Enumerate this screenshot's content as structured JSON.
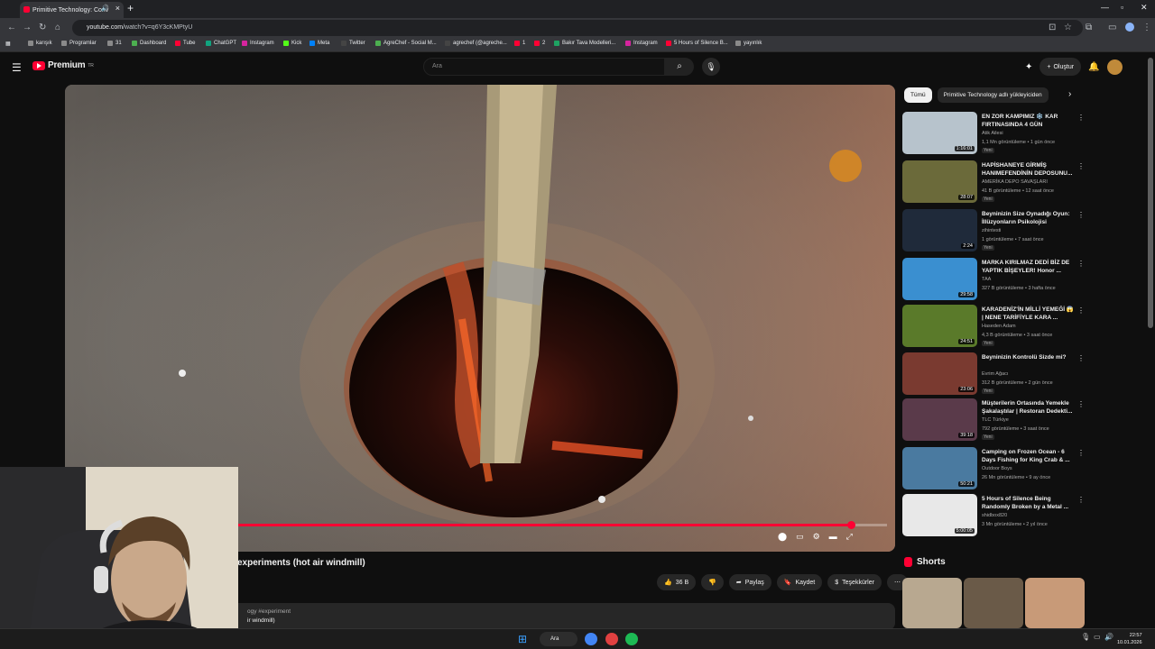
{
  "browser": {
    "tab_title": "Primitive Technology: Conv",
    "url_domain": "youtube.com",
    "url_path": "/watch?v=q6Y3cKMPtyU",
    "bookmarks": [
      "karışık",
      "Programlar",
      "31",
      "Dashboard",
      "Tube",
      "ChatGPT",
      "Instagram",
      "Kick",
      "Meta",
      "Twitter",
      "AgreChef - Social M...",
      "agrechef (@agreche...",
      "1",
      "2",
      "Bakır Tava Modelleri...",
      "Instagram",
      "5 Hours of Silence B...",
      "yayınlık"
    ]
  },
  "youtube": {
    "logo_text": "Premium",
    "logo_sup": "TR",
    "search_placeholder": "Ara",
    "create_label": "Oluştur"
  },
  "video": {
    "title_visible": "experiments (hot air windmill)",
    "progress": 0.945,
    "like_count": "36 B",
    "share_label": "Paylaş",
    "save_label": "Kaydet",
    "thanks_label": "Teşekkürler",
    "description_tags": "ogy #experiment",
    "description_line": "ir windmill)"
  },
  "sidebar": {
    "chips": [
      "Tümü",
      "Primitive Technology adlı yükleyiciden"
    ],
    "recommendations": [
      {
        "title": "EN ZOR KAMPIMIZ ❄️ KAR FIRTINASINDA 4 GÜN",
        "channel": "Atik Ailesi",
        "meta": "1,1 Mn görüntüleme • 1 gün önce",
        "badge": "Yeni",
        "duration": "1:16:01",
        "thumb": "#b7c3cc"
      },
      {
        "title": "HAPİSHANEYE GİRMİŞ HANIMEFENDİNİN DEPOSUNU...",
        "channel": "AMERİKA DEPO SAVAŞLARI",
        "meta": "41 B görüntüleme • 12 saat önce",
        "badge": "Yeni",
        "duration": "28:07",
        "thumb": "#6b6a3a"
      },
      {
        "title": "Beyninizin Size Oynadığı Oyun: İllüzyonların Psikolojisi",
        "channel": "zihintesti",
        "meta": "1 görüntüleme • 7 saat önce",
        "badge": "Yeni",
        "duration": "2:24",
        "thumb": "#1f2a3a"
      },
      {
        "title": "MARKA KIRILMAZ DEDİ BİZ DE YAPTIK BİŞEYLER! Honor ...",
        "channel": "TAA",
        "meta": "327 B görüntüleme • 3 hafta önce",
        "badge": "",
        "duration": "29:58",
        "thumb": "#3a8fd0"
      },
      {
        "title": "KARADENİZ'İN MİLLİ YEMEĞİ 😱 | NENE TARİFİYLE KARA ...",
        "channel": "Haseden Adam",
        "meta": "4,3 B görüntüleme • 3 saat önce",
        "badge": "Yeni",
        "duration": "24:51",
        "thumb": "#5a7a2a"
      },
      {
        "title": "Beyninizin Kontrolü Sizde mi?",
        "channel": "Evrim Ağacı",
        "meta": "312 B görüntüleme • 2 gün önce",
        "badge": "Yeni",
        "duration": "23:06",
        "thumb": "#7a3a30"
      },
      {
        "title": "Müşterilerin Ortasında Yemekle Şakalaştılar | Restoran Dedekti...",
        "channel": "TLC Türkiye",
        "meta": "792 görüntüleme • 3 saat önce",
        "badge": "Yeni",
        "duration": "39:18",
        "thumb": "#5a3a4a"
      },
      {
        "title": "Camping on Frozen Ocean - 6 Days Fishing for King Crab & ...",
        "channel": "Outdoor Boys",
        "meta": "26 Mn görüntüleme • 9 ay önce",
        "badge": "",
        "duration": "50:21",
        "thumb": "#4a7aa0"
      },
      {
        "title": "5 Hours of Silence Being Randomly Broken by a Metal ...",
        "channel": "shidbox820",
        "meta": "3 Mn görüntüleme • 2 yıl önce",
        "badge": "",
        "duration": "5:00:05",
        "thumb": "#e8e8e8"
      }
    ],
    "shorts_label": "Shorts"
  },
  "taskbar": {
    "search_label": "Ara",
    "time": "22:57",
    "date": "10.01.2026"
  }
}
